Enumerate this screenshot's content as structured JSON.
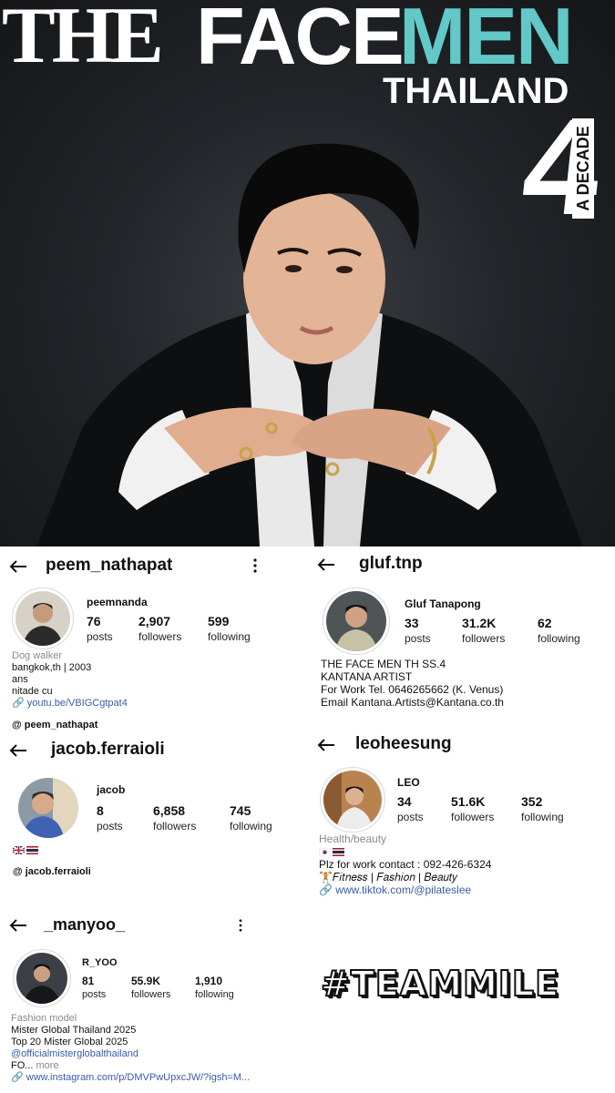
{
  "poster": {
    "title_the": "THE",
    "title_face": "FACE",
    "title_men": "MEN",
    "subtitle": "THAILAND",
    "season_number": "4",
    "season_tag": "A DECADE"
  },
  "profiles": [
    {
      "handle": "peem_nathapat",
      "display_name": "peemnanda",
      "posts": "76",
      "posts_label": "posts",
      "followers": "2,907",
      "followers_label": "followers",
      "following": "599",
      "following_label": "following",
      "category": "Dog walker",
      "bio_lines": [
        "bangkok,th | 2003",
        "ans",
        "nitade cu"
      ],
      "link": "youtu.be/VBIGCgtpat4",
      "threads": "peem_nathapat"
    },
    {
      "handle": "gluf.tnp",
      "display_name": "Gluf Tanapong",
      "posts": "33",
      "posts_label": "posts",
      "followers": "31.2K",
      "followers_label": "followers",
      "following": "62",
      "following_label": "following",
      "bio_lines": [
        "THE FACE MEN TH SS.4",
        "KANTANA ARTIST",
        "For Work Tel. 0646265662 (K. Venus)",
        "Email Kantana.Artists@Kantana.co.th"
      ]
    },
    {
      "handle": "jacob.ferraioli",
      "display_name": "jacob",
      "posts": "8",
      "posts_label": "posts",
      "followers": "6,858",
      "followers_label": "followers",
      "following": "745",
      "following_label": "following",
      "threads": "jacob.ferraioli"
    },
    {
      "handle": "leoheesung",
      "display_name": "LEO",
      "posts": "34",
      "posts_label": "posts",
      "followers": "51.6K",
      "followers_label": "followers",
      "following": "352",
      "following_label": "following",
      "category": "Health/beauty",
      "bio_lines": [
        "Plz for work contact : 092-426-6324",
        "🏋𝐹𝑖𝑡𝑛𝑒𝑠𝑠 | 𝐹𝑎𝑠ℎ𝑖𝑜𝑛 | 𝐵𝑒𝑎𝑢𝑡𝑦"
      ],
      "link": "www.tiktok.com/@pilateslee"
    },
    {
      "handle": "_manyoo_",
      "display_name": "R_YOO",
      "posts": "81",
      "posts_label": "posts",
      "followers": "55.9K",
      "followers_label": "followers",
      "following": "1,910",
      "following_label": "following",
      "category": "Fashion model",
      "bio_lines": [
        "Mister Global Thailand 2025",
        "Top 20 Mister Global 2025"
      ],
      "mention": "@officialmisterglobalthailand",
      "truncated": "FO...",
      "more": "more",
      "link": "www.instagram.com/p/DMVPwUpxcJW/?igsh=M..."
    }
  ],
  "hashtag": "#TEAMMILE"
}
